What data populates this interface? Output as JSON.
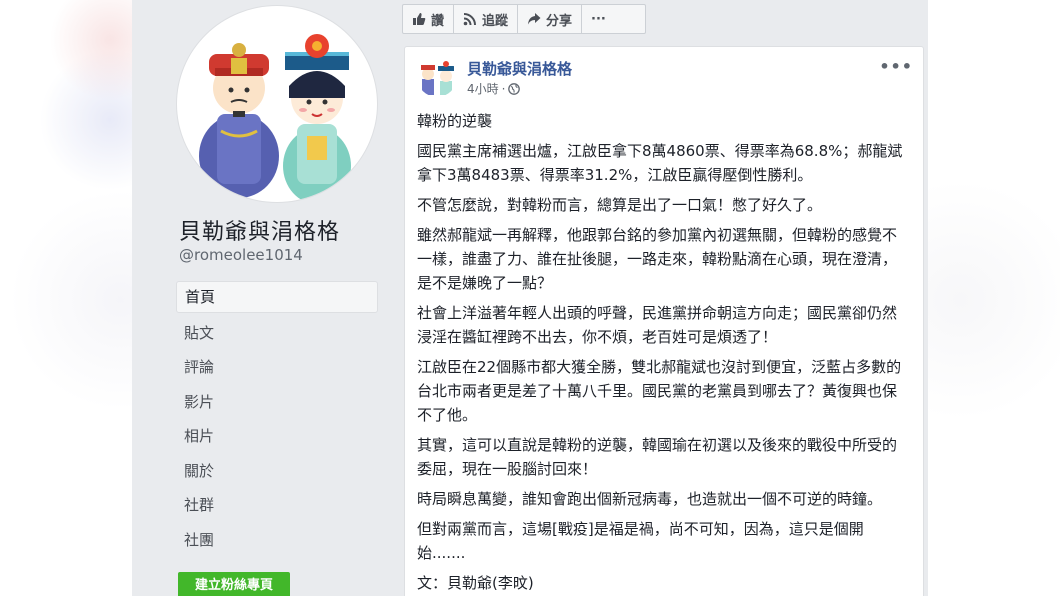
{
  "page": {
    "name": "貝勒爺與涓格格",
    "handle": "@romeolee1014"
  },
  "nav": {
    "items": [
      "首頁",
      "貼文",
      "評論",
      "影片",
      "相片",
      "關於",
      "社群",
      "社團"
    ],
    "active": "首頁"
  },
  "create_button": "建立粉絲專頁",
  "action_bar": {
    "like": "讚",
    "follow": "追蹤",
    "share": "分享",
    "more": "···"
  },
  "post": {
    "author": "貝勒爺與涓格格",
    "time": "4小時",
    "paragraphs": [
      "韓粉的逆襲",
      "國民黨主席補選出爐，江啟臣拿下8萬4860票、得票率為68.8%；郝龍斌拿下3萬8483票、得票率31.2%，江啟臣贏得壓倒性勝利。",
      "不管怎麼說，對韓粉而言，總算是出了一口氣！憋了好久了。",
      "雖然郝龍斌一再解釋，他跟郭台銘的參加黨內初選無關，但韓粉的感覺不一樣，誰盡了力、誰在扯後腿，一路走來，韓粉點滴在心頭，現在澄清，是不是嫌晚了一點？",
      "社會上洋溢著年輕人出頭的呼聲，民進黨拼命朝這方向走；國民黨卻仍然浸淫在醬缸裡跨不出去，你不煩，老百姓可是煩透了！",
      "江啟臣在22個縣市都大獲全勝，雙北郝龍斌也沒討到便宜，泛藍占多數的台北市兩者更是差了十萬八千里。國民黨的老黨員到哪去了？黃復興也保不了他。",
      "其實，這可以直說是韓粉的逆襲，韓國瑜在初選以及後來的戰役中所受的委屈，現在一股腦討回來！",
      "時局瞬息萬變，誰知會跑出個新冠病毒，也造就出一個不可逆的時鐘。",
      "但對兩黨而言，這場[戰疫]是福是禍，尚不可知，因為，這只是個開始.......",
      "文：貝勒爺(李旼)"
    ]
  },
  "colors": {
    "link": "#385898",
    "green": "#42b72a",
    "page_bg": "#e9ebee"
  }
}
